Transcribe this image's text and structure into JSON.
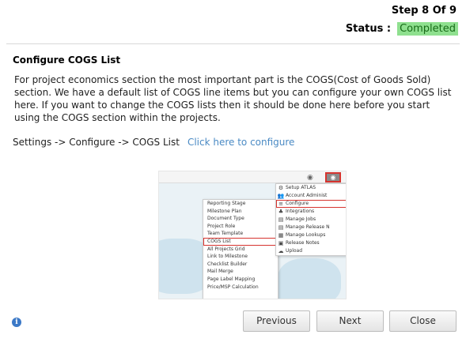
{
  "header": {
    "step_text": "Step 8 Of 9",
    "status_label": "Status :",
    "status_value": "Completed",
    "status_color": "#8fe08f"
  },
  "section": {
    "title": "Configure COGS List",
    "description": "For project economics section the most important part is the COGS(Cost of Goods Sold) section. We have a default list of COGS line items but you can configure your own COGS list here. If you want to change the COGS lists then it should be done here before you start using the COGS section within the projects.",
    "path_text": "Settings -> Configure -> COGS List",
    "link_text": "Click here to configure",
    "link_color": "#4a8ac4"
  },
  "preview": {
    "left_menu": [
      "Reporting Stage",
      "Milestone Plan",
      "Document Type",
      "Project Role",
      "Team Template",
      "COGS List",
      "All Projects Grid",
      "Link to Milestone",
      "Checklist Builder",
      "Mail Merge",
      "Page Label Mapping",
      "Price/MSP Calculation"
    ],
    "right_menu": [
      {
        "icon": "gear-icon",
        "glyph": "⚙",
        "label": "Setup ATLAS"
      },
      {
        "icon": "users-icon",
        "glyph": "👥",
        "label": "Account Administ"
      },
      {
        "icon": "configure-icon",
        "glyph": "≡",
        "label": "Configure"
      },
      {
        "icon": "integrations-icon",
        "glyph": "♣",
        "label": "Integrations"
      },
      {
        "icon": "jobs-icon",
        "glyph": "▤",
        "label": "Manage Jobs"
      },
      {
        "icon": "release-icon",
        "glyph": "▤",
        "label": "Manage Release N"
      },
      {
        "icon": "lookups-icon",
        "glyph": "▦",
        "label": "Manage Lookups"
      },
      {
        "icon": "notes-icon",
        "glyph": "▣",
        "label": "Release Notes"
      },
      {
        "icon": "upload-icon",
        "glyph": "☁",
        "label": "Upload"
      }
    ]
  },
  "footer": {
    "info_icon": "i",
    "previous_label": "Previous",
    "next_label": "Next",
    "close_label": "Close"
  }
}
